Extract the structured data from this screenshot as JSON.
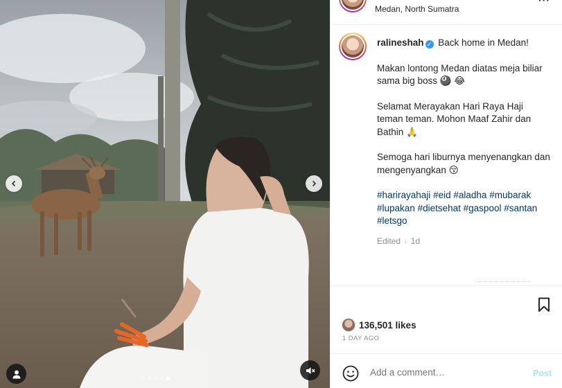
{
  "post": {
    "location": "Medan, North Sumatra",
    "username": "ralineshah",
    "verified_mark": "✓",
    "caption_first_line": "Back home in Medan!",
    "paragraphs": [
      "Makan lontong Medan diatas meja biliar sama big boss 🎱 😂",
      "Selamat Merayakan Hari Raya Haji teman teman. Mohon Maaf Zahir dan Bathin 🙏",
      "Semoga hari liburnya menyenangkan dan mengenyangkan 😚"
    ],
    "hashtags": [
      "#harirayahaji",
      "#eid",
      "#aladha",
      "#mubarak",
      "#lupakan",
      "#dietsehat",
      "#gaspool",
      "#santan",
      "#letsgo"
    ],
    "edited_label": "Edited",
    "edited_sep": "·",
    "edited_time": "1d",
    "likes": "136,501 likes",
    "date": "1 DAY AGO",
    "more_label": "···"
  },
  "comment": {
    "placeholder": "Add a comment…",
    "post_label": "Post"
  },
  "media": {
    "carousel_count": 5,
    "active_index": 4
  },
  "icons": {
    "prev": "chevron-left-icon",
    "next": "chevron-right-icon",
    "tag": "user-tag-icon",
    "mute": "speaker-muted-icon",
    "bookmark": "bookmark-icon",
    "emoji": "emoji-icon",
    "verified": "verified-badge-icon"
  },
  "colors": {
    "link": "#00376b",
    "muted": "#8e8e8e",
    "verified": "#3897f0",
    "post_button": "#b2dffc"
  }
}
